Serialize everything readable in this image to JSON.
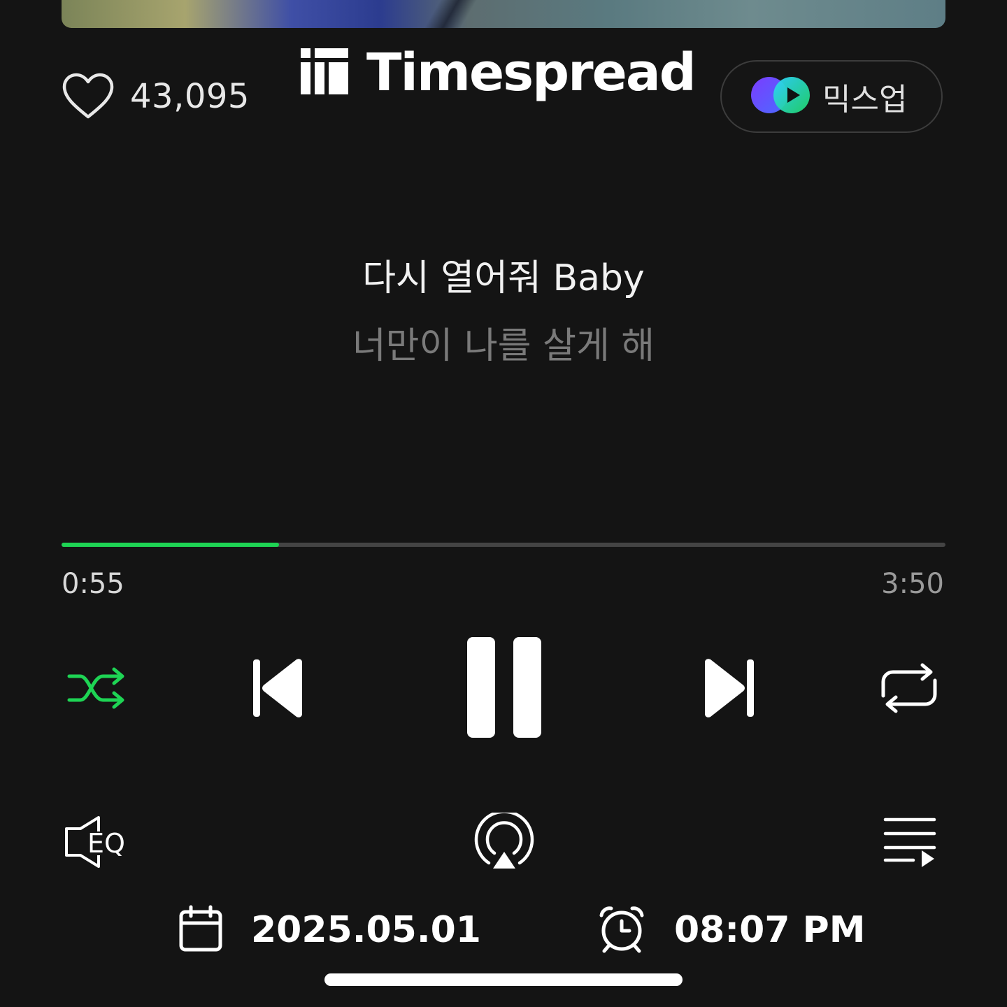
{
  "album_art": {
    "icon": "album-art-image"
  },
  "like": {
    "icon": "heart-outline-icon",
    "count": "43,095"
  },
  "brand": {
    "logo_icon": "timespread-logo-icon",
    "name": "Timespread"
  },
  "mixup": {
    "icon": "mixup-logo-icon",
    "label": "믹스업"
  },
  "lyrics": {
    "current": "다시 열어줘 Baby",
    "next": "너만이 나를 살게 해"
  },
  "progress": {
    "elapsed": "0:55",
    "total": "3:50",
    "fraction": 0.246,
    "fill_color": "#1ed454",
    "track_color": "#444444"
  },
  "controls": {
    "shuffle": {
      "icon": "shuffle-icon",
      "active": true,
      "color": "#1ed454"
    },
    "previous": {
      "icon": "skip-previous-icon"
    },
    "play_pause": {
      "icon": "pause-icon"
    },
    "next": {
      "icon": "skip-next-icon"
    },
    "repeat": {
      "icon": "repeat-icon"
    }
  },
  "secondary": {
    "eq": {
      "icon": "equalizer-icon",
      "label": "EQ"
    },
    "airplay": {
      "icon": "airplay-icon"
    },
    "queue": {
      "icon": "playlist-queue-icon"
    }
  },
  "footer": {
    "date_icon": "calendar-icon",
    "date": "2025.05.01",
    "time_icon": "alarm-clock-icon",
    "time": "08:07 PM"
  }
}
